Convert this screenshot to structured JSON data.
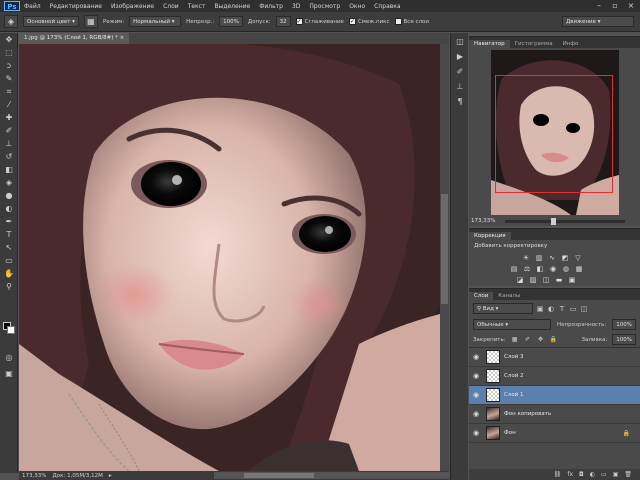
{
  "app": {
    "logo": "Ps"
  },
  "menu": [
    "Файл",
    "Редактирование",
    "Изображение",
    "Слои",
    "Текст",
    "Выделение",
    "Фильтр",
    "3D",
    "Просмотр",
    "Окно",
    "Справка"
  ],
  "options": {
    "tool_preset": "Основной цвет",
    "mode_label": "Режим:",
    "mode_value": "Нормальный",
    "opacity_label": "Непрозр.:",
    "opacity_value": "100%",
    "tolerance_label": "Допуск:",
    "tolerance_value": "32",
    "antialias_label": "Сглаживание",
    "contiguous_label": "Смеж.пикс",
    "all_layers_label": "Все слои",
    "workspace": "Движение"
  },
  "document": {
    "tab_title": "1.jpg @ 173% (Слой 1, RGB/8#) *",
    "zoom": "173,33%",
    "doc_info": "Док: 1,05M/3,12M"
  },
  "navigator": {
    "tabs": [
      "Навигатор",
      "Гистограмма",
      "Инфо"
    ],
    "zoom": "173,33%",
    "zoom_level": 0.4
  },
  "corrections": {
    "tab": "Коррекция",
    "hint": "Добавить корректировку"
  },
  "layers_panel": {
    "tabs": [
      "Слои",
      "Каналы"
    ],
    "filter": "Вид",
    "blend_mode": "Обычные",
    "opacity_label": "Непрозрачность:",
    "opacity_value": "100%",
    "lock_label": "Закрепить:",
    "fill_label": "Заливка:",
    "fill_value": "100%",
    "layers": [
      {
        "name": "Слой 3",
        "active": false
      },
      {
        "name": "Слой 2",
        "active": false
      },
      {
        "name": "Слой 1",
        "active": true
      },
      {
        "name": "Фон копировать",
        "active": false
      },
      {
        "name": "Фон",
        "active": false
      }
    ]
  },
  "colors": {
    "accent": "#5b7fae",
    "red_frame": "#e03030"
  }
}
